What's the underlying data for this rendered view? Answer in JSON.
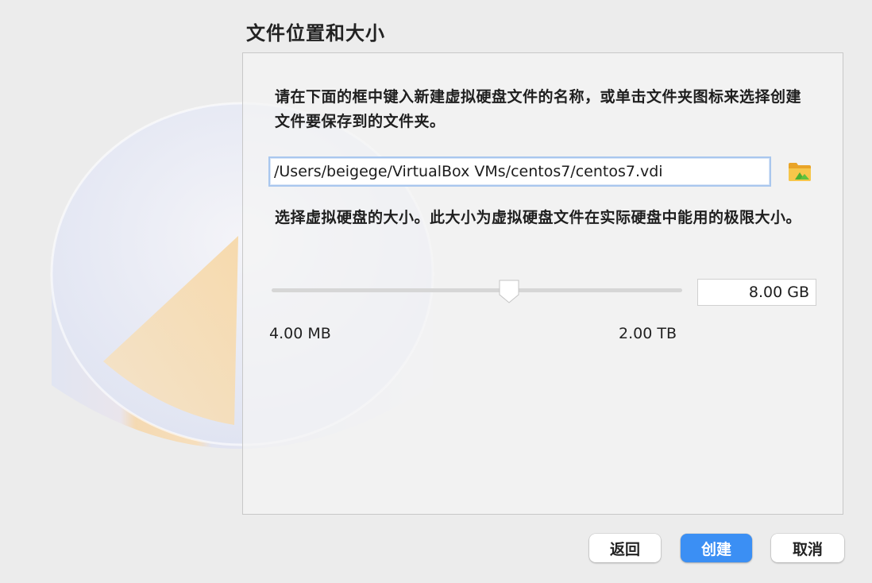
{
  "dialog": {
    "title": "文件位置和大小"
  },
  "location": {
    "description": "请在下面的框中键入新建虚拟硬盘文件的名称，或单击文件夹图标来选择创建文件要保存到的文件夹。",
    "path_value": "/Users/beigege/VirtualBox VMs/centos7/centos7.vdi",
    "folder_icon": "folder-icon"
  },
  "size": {
    "description": "选择虚拟硬盘的大小。此大小为虚拟硬盘文件在实际硬盘中能用的极限大小。",
    "value": "8.00 GB",
    "min_label": "4.00 MB",
    "max_label": "2.00 TB",
    "slider_position_fraction": 0.578
  },
  "buttons": {
    "back": "返回",
    "create": "创建",
    "cancel": "取消"
  },
  "colors": {
    "accent": "#3b8ff4",
    "focus_ring": "#a9c7ee",
    "window_bg": "#ececec"
  }
}
